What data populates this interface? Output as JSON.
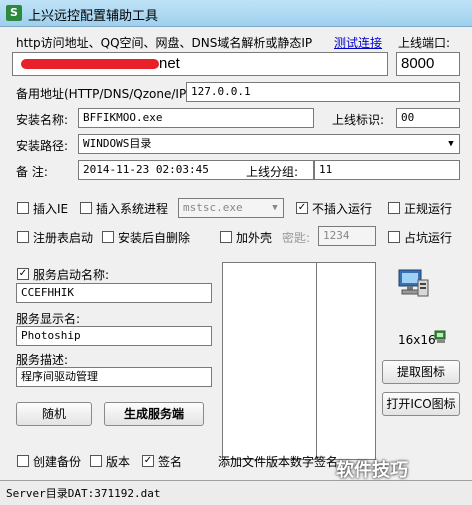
{
  "window": {
    "title": "上兴远控配置辅助工具",
    "icon": "app-icon"
  },
  "address": {
    "label": "http访问地址、QQ空间、网盘、DNS域名解析或静态IP",
    "test_link": "测试连接",
    "port_label": "上线端口:",
    "url_value": "net",
    "port_value": "8000"
  },
  "backup": {
    "label": "备用地址(HTTP/DNS/Qzone/IP):",
    "value": "127.0.0.1"
  },
  "install_name": {
    "label": "安装名称:",
    "value": "BFFIKMOO.exe"
  },
  "online_id": {
    "label": "上线标识:",
    "value": "00"
  },
  "install_path": {
    "label": "安装路径:",
    "value": "WINDOWS目录"
  },
  "note": {
    "label": "备 注:",
    "value": "2014-11-23 02:03:45"
  },
  "group": {
    "label": "上线分组:",
    "value": "11"
  },
  "options": {
    "inject_ie": {
      "label": "插入IE",
      "checked": false
    },
    "inject_process": {
      "label": "插入系统进程",
      "checked": false
    },
    "process_select": "mstsc.exe",
    "no_inject_run": {
      "label": "不插入运行",
      "checked": true
    },
    "normal_run": {
      "label": "正规运行",
      "checked": false
    },
    "registry_start": {
      "label": "注册表启动",
      "checked": false
    },
    "self_delete": {
      "label": "安装后自删除",
      "checked": false
    },
    "add_shell": {
      "label": "加外壳",
      "checked": false
    },
    "password_label": "密匙:",
    "password_value": "1234",
    "occupy_run": {
      "label": "占坑运行",
      "checked": false
    }
  },
  "service": {
    "start_name_label": "服务启动名称:",
    "start_name_checked": true,
    "start_name_value": "CCEFHHIK",
    "display_label": "服务显示名:",
    "display_value": "Photoship",
    "desc_label": "服务描述:",
    "desc_value": "程序间驱动管理"
  },
  "icon_panel": {
    "size_label": "16x16"
  },
  "buttons": {
    "random": "随机",
    "generate": "生成服务端",
    "extract_icon": "提取图标",
    "open_ico": "打开ICO图标"
  },
  "bottom": {
    "create_backup": {
      "label": "创建备份",
      "checked": false
    },
    "version": {
      "label": "版本",
      "checked": false
    },
    "signature": {
      "label": "签名",
      "checked": true
    },
    "add_version_text": "添加文件版本数字签名"
  },
  "status": {
    "text": "Server目录DAT:371192.dat"
  },
  "watermark": "软件技巧"
}
